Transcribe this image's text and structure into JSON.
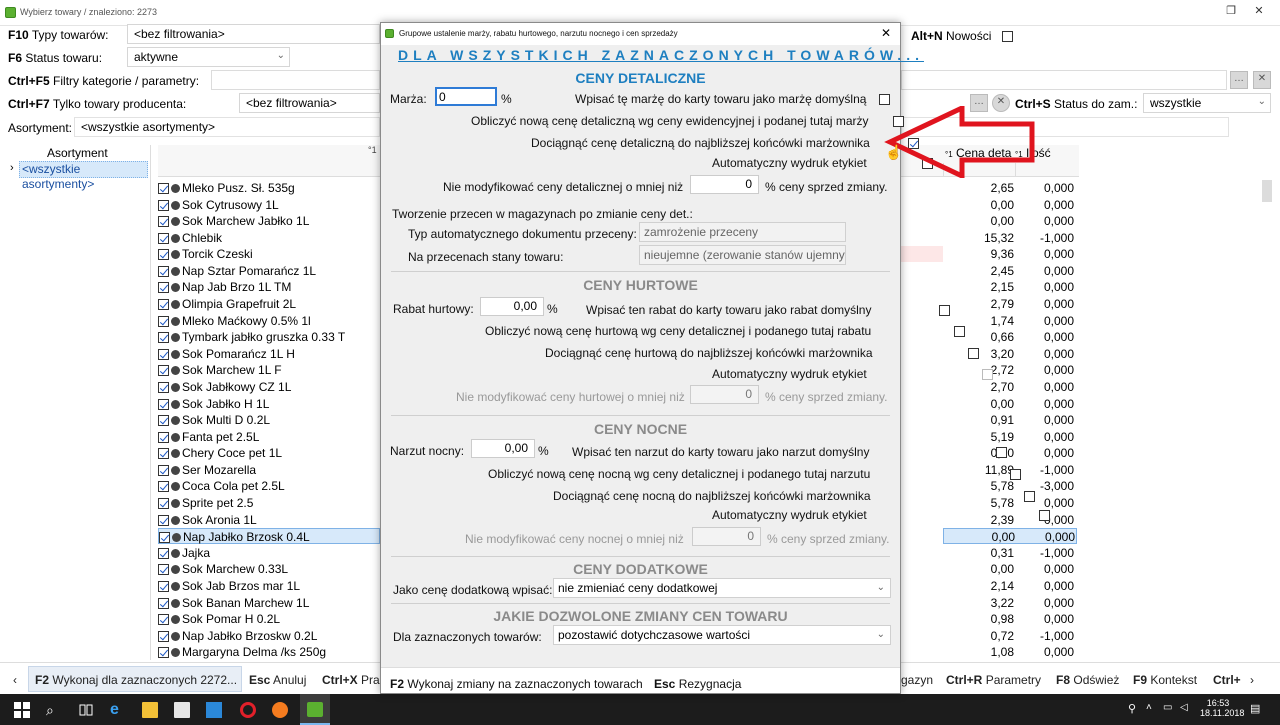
{
  "window": {
    "title": "Wybierz towary / znaleziono: 2273"
  },
  "filters": {
    "f10_key": "F10",
    "f10_label": "Typy towarów:",
    "f10_value": "<bez filtrowania>",
    "altn_key": "Alt+N",
    "altn_label": "Nowości",
    "f6_key": "F6",
    "f6_label": "Status towaru:",
    "f6_value": "aktywne",
    "ctrlf5_key": "Ctrl+F5",
    "ctrlf5_label": "Filtry kategorie / parametry:",
    "ctrlf7_key": "Ctrl+F7",
    "ctrlf7_label": "Tylko towary producenta:",
    "ctrlf7_value": "<bez filtrowania>",
    "ctrls_key": "Ctrl+S",
    "ctrls_label": "Status do zam.:",
    "ctrls_value": "wszystkie",
    "asort_label": "Asortyment:",
    "asort_value": "<wszystkie asortymenty>"
  },
  "tree": {
    "header": "Asortyment",
    "item": "<wszystkie asortymenty>"
  },
  "grid": {
    "headers": {
      "price": "Cena deta",
      "qty": "Ilość"
    },
    "rows": [
      {
        "name": "Mleko Pusz. Sł. 535g",
        "price": "2,65",
        "qty": "0,000"
      },
      {
        "name": "Sok Cytrusowy 1L",
        "price": "0,00",
        "qty": "0,000"
      },
      {
        "name": "Sok Marchew Jabłko 1L",
        "price": "0,00",
        "qty": "0,000"
      },
      {
        "name": "Chlebik",
        "price": "15,32",
        "qty": "-1,000"
      },
      {
        "name": "Torcik Czeski",
        "price": "9,36",
        "qty": "0,000"
      },
      {
        "name": "Nap Sztar Pomarańcz 1L",
        "price": "2,45",
        "qty": "0,000"
      },
      {
        "name": "Nap Jab Brzo 1L TM",
        "price": "2,15",
        "qty": "0,000"
      },
      {
        "name": "Olimpia Grapefruit 2L",
        "price": "2,79",
        "qty": "0,000"
      },
      {
        "name": "Mleko Maćkowy 0.5% 1l",
        "price": "1,74",
        "qty": "0,000"
      },
      {
        "name": "Tymbark jabłko gruszka 0.33 T",
        "price": "0,66",
        "qty": "0,000"
      },
      {
        "name": "Sok Pomarańcz 1L H",
        "price": "3,20",
        "qty": "0,000"
      },
      {
        "name": "Sok Marchew 1L F",
        "price": "2,72",
        "qty": "0,000"
      },
      {
        "name": "Sok Jabłkowy CZ 1L",
        "price": "2,70",
        "qty": "0,000"
      },
      {
        "name": "Sok Jabłko H 1L",
        "price": "0,00",
        "qty": "0,000"
      },
      {
        "name": "Sok Multi D 0.2L",
        "price": "0,91",
        "qty": "0,000"
      },
      {
        "name": "Fanta pet 2.5L",
        "price": "5,19",
        "qty": "0,000"
      },
      {
        "name": "Chery Coce pet 1L",
        "price": "0,00",
        "qty": "0,000"
      },
      {
        "name": "Ser Mozarella",
        "price": "11,89",
        "qty": "-1,000"
      },
      {
        "name": "Coca Cola pet 2.5L",
        "price": "5,78",
        "qty": "-3,000"
      },
      {
        "name": "Sprite pet 2.5",
        "price": "5,78",
        "qty": "0,000"
      },
      {
        "name": "Sok Aronia 1L",
        "price": "2,39",
        "qty": "0,000"
      },
      {
        "name": "Nap Jabłko Brzosk 0.4L",
        "price": "0,00",
        "qty": "0,000"
      },
      {
        "name": "Jajka",
        "price": "0,31",
        "qty": "-1,000"
      },
      {
        "name": "Sok Marchew 0.33L",
        "price": "0,00",
        "qty": "0,000"
      },
      {
        "name": "Sok Jab Brzos mar 1L",
        "price": "2,14",
        "qty": "0,000"
      },
      {
        "name": "Sok Banan Marchew 1L",
        "price": "3,22",
        "qty": "0,000"
      },
      {
        "name": "Sok Pomar H 0.2L",
        "price": "0,98",
        "qty": "0,000"
      },
      {
        "name": "Nap Jabłko Brzoskw 0.2L",
        "price": "0,72",
        "qty": "-1,000"
      },
      {
        "name": "Margaryna Delma /ks 250g",
        "price": "1,08",
        "qty": "0,000"
      }
    ]
  },
  "bottombar": {
    "f2_key": "F2",
    "f2_label": "Wykonaj dla zaznaczonych 2272...",
    "esc_key": "Esc",
    "esc_label": "Anuluj",
    "ctrlx_key": "Ctrl+X",
    "ctrlx_label": "Pra",
    "mag_label": "gazyn",
    "ctrlr_key": "Ctrl+R",
    "ctrlr_label": "Parametry",
    "f8_key": "F8",
    "f8_label": "Odśwież",
    "f9_key": "F9",
    "f9_label": "Kontekst",
    "ctrlplus_key": "Ctrl+"
  },
  "taskbar": {
    "time": "16:53",
    "date": "18.11.2018"
  },
  "dialog": {
    "title": "Grupowe ustalenie marży, rabatu hurtowego, narzutu nocnego i cen sprzedaży",
    "heading": "DLA WSZYSTKICH ZAZNACZONYCH TOWARÓW...",
    "retail": {
      "section": "CENY DETALICZNE",
      "margin_label": "Marża:",
      "margin_value": "0",
      "margin_unit": "%",
      "default_label": "Wpisać tę marżę do karty towaru jako marżę domyślną",
      "calc_label": "Obliczyć nową cenę detaliczną wg ceny ewidencyjnej i podanej tutaj marży",
      "round_label": "Dociągnąć cenę detaliczną do najbliższej końcówki marżownika",
      "print_label": "Automatyczny wydruk etykiet",
      "nomod_label": "Nie modyfikować ceny detalicznej o mniej niż",
      "nomod_value": "0",
      "nomod_unit": "% ceny sprzed zmiany.",
      "reprice_title": "Tworzenie przecen w magazynach po zmianie ceny det.:",
      "doctype_label": "Typ automatycznego dokumentu przeceny:",
      "doctype_value": "zamrożenie przeceny",
      "stock_label": "Na przecenach stany towaru:",
      "stock_value": "nieujemne (zerowanie stanów ujemnych)"
    },
    "wholesale": {
      "section": "CENY HURTOWE",
      "rebate_label": "Rabat hurtowy:",
      "rebate_value": "0,00",
      "rebate_unit": "%",
      "default_label": "Wpisać ten rabat do karty towaru jako rabat domyślny",
      "calc_label": "Obliczyć nową cenę hurtową wg ceny detalicznej i podanego tutaj rabatu",
      "round_label": "Dociągnąć cenę hurtową do najbliższej końcówki marżownika",
      "print_label": "Automatyczny wydruk etykiet",
      "nomod_label": "Nie modyfikować ceny hurtowej o mniej niż",
      "nomod_value": "0",
      "nomod_unit": "% ceny sprzed zmiany."
    },
    "night": {
      "section": "CENY NOCNE",
      "markup_label": "Narzut nocny:",
      "markup_value": "0,00",
      "markup_unit": "%",
      "default_label": "Wpisać ten narzut do karty towaru jako narzut domyślny",
      "calc_label": "Obliczyć nową cenę nocną wg ceny detalicznej i podanego tutaj narzutu",
      "round_label": "Dociągnąć cenę nocną do najbliższej końcówki marżownika",
      "print_label": "Automatyczny wydruk etykiet",
      "nomod_label": "Nie modyfikować ceny nocnej o mniej niż",
      "nomod_value": "0",
      "nomod_unit": "% ceny sprzed zmiany."
    },
    "extra": {
      "section": "CENY DODATKOWE",
      "label": "Jako cenę dodatkową wpisać:",
      "value": "nie zmieniać ceny dodatkowej"
    },
    "allowed": {
      "section": "JAKIE DOZWOLONE ZMIANY CEN TOWARU",
      "label": "Dla zaznaczonych towarów:",
      "value": "pozostawić dotychczasowe wartości"
    },
    "footer": {
      "f2_key": "F2",
      "f2_label": "Wykonaj zmiany na zaznaczonych towarach",
      "esc_key": "Esc",
      "esc_label": "Rezygnacja"
    }
  },
  "colors": {
    "accent": "#1e7fc0",
    "arrow": "#e0141e",
    "section": "#8a8a8a"
  }
}
